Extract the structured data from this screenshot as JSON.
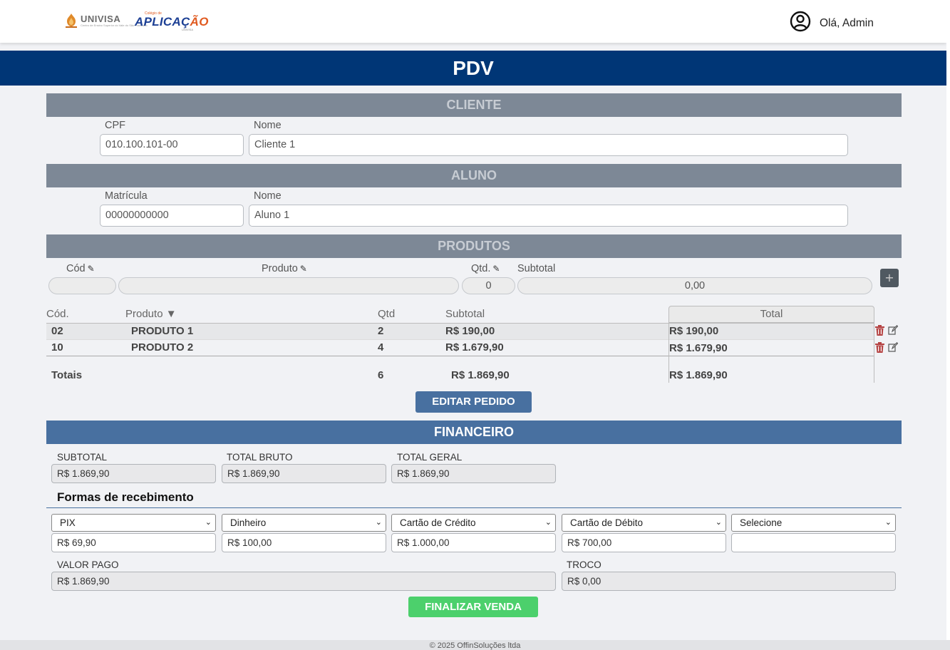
{
  "header": {
    "logo1_text": "UNIVISA",
    "logo1_sub": "Centro de Ensino Superior do Vale do São Francisco",
    "logo2_small": "Colégio de",
    "logo2_big_a": "APLICAÇ",
    "logo2_big_b": "ÃO",
    "logo2_under": "UNIVISA",
    "greeting": "Olá, Admin",
    "user_icon": "user-circle-icon"
  },
  "page_title": "PDV",
  "cliente": {
    "section_title": "CLIENTE",
    "cpf_label": "CPF",
    "cpf_value": "010.100.101-00",
    "nome_label": "Nome",
    "nome_value": "Cliente 1"
  },
  "aluno": {
    "section_title": "ALUNO",
    "matricula_label": "Matrícula",
    "matricula_value": "00000000000",
    "nome_label": "Nome",
    "nome_value": "Aluno 1"
  },
  "produtos": {
    "section_title": "PRODUTOS",
    "cod_label": "Cód",
    "produto_label": "Produto",
    "qtd_label": "Qtd.",
    "subtotal_label": "Subtotal",
    "qtd_value": "0",
    "subtotal_value": "0,00",
    "add_label": "+",
    "table": {
      "headers": {
        "cod": "Cód.",
        "produto": "Produto ▼",
        "qtd": "Qtd",
        "subtotal": "Subtotal",
        "total": "Total"
      },
      "rows": [
        {
          "cod": "02",
          "produto": "PRODUTO 1",
          "qtd": "2",
          "subtotal": "R$ 190,00",
          "total": "R$ 190,00"
        },
        {
          "cod": "10",
          "produto": "PRODUTO 2",
          "qtd": "4",
          "subtotal": "R$ 1.679,90",
          "total": "R$ 1.679,90"
        }
      ],
      "totals": {
        "label": "Totais",
        "qtd": "6",
        "subtotal": "R$ 1.869,90",
        "total": "R$ 1.869,90"
      }
    },
    "edit_button": "EDITAR PEDIDO"
  },
  "financeiro": {
    "section_title": "FINANCEIRO",
    "subtotal_label": "SUBTOTAL",
    "subtotal_value": "R$ 1.869,90",
    "total_bruto_label": "TOTAL BRUTO",
    "total_bruto_value": "R$ 1.869,90",
    "total_geral_label": "TOTAL GERAL",
    "total_geral_value": "R$ 1.869,90",
    "formas_title": "Formas de recebimento",
    "formas": [
      {
        "method": "PIX",
        "value": "R$ 69,90"
      },
      {
        "method": "Dinheiro",
        "value": "R$ 100,00"
      },
      {
        "method": "Cartão de Crédito",
        "value": "R$ 1.000,00"
      },
      {
        "method": "Cartão de Débito",
        "value": "R$ 700,00"
      },
      {
        "method": "Selecione",
        "value": ""
      }
    ],
    "valor_pago_label": "VALOR PAGO",
    "valor_pago_value": "R$ 1.869,90",
    "troco_label": "TROCO",
    "troco_value": "R$ 0,00",
    "finalize_button": "FINALIZAR VENDA"
  },
  "footer": "© 2025 OffinSoluções ltda",
  "colors": {
    "banner": "#003676",
    "section_gray": "#7d8896",
    "section_blue": "#4870a0",
    "finalize_green": "#4cd06c",
    "trash_red": "#b54343"
  }
}
